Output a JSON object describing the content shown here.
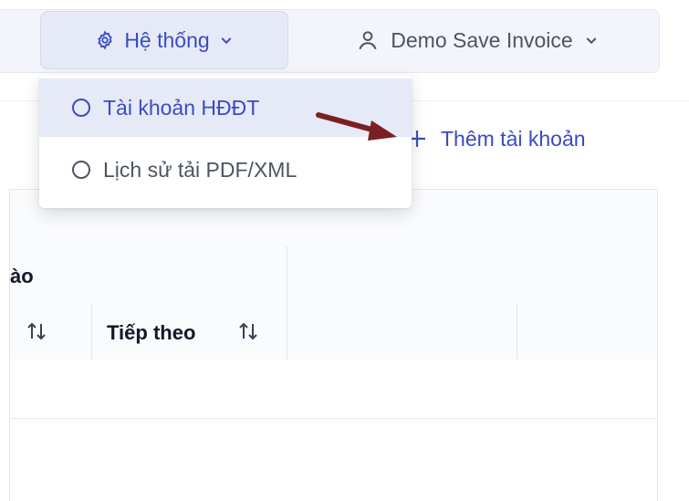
{
  "header": {
    "system_menu_label": "Hệ thống",
    "user_menu_label": "Demo Save Invoice"
  },
  "dropdown": {
    "items": [
      {
        "label": "Tài khoản HĐĐT",
        "active": true
      },
      {
        "label": "Lịch sử tải PDF/XML",
        "active": false
      }
    ]
  },
  "toolbar": {
    "add_account_label": "Thêm tài khoản"
  },
  "table": {
    "group_header_partial": "ào",
    "columns": [
      {
        "label": ""
      },
      {
        "label": "Tiếp theo"
      }
    ]
  },
  "colors": {
    "accent": "#3b4cc0",
    "accent_bg": "#e6e9f6",
    "arrow": "#7a1f24"
  },
  "icons": {
    "system": "gear-icon",
    "user": "user-icon",
    "chevron": "chevron-down-icon",
    "add": "plus-icon",
    "sort": "sort-icon",
    "radio": "radio-icon"
  }
}
